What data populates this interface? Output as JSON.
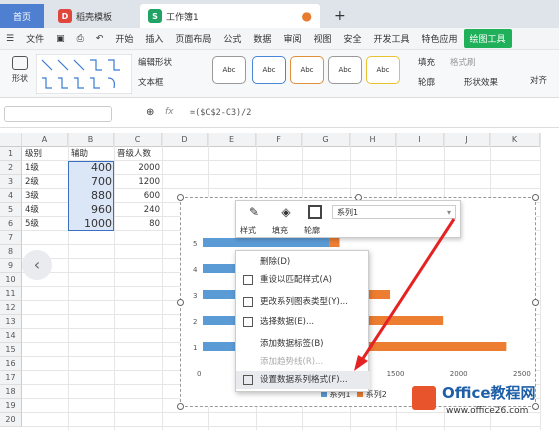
{
  "tabs": {
    "home": "首页",
    "template": "稻壳模板",
    "workbook": "工作簿1",
    "new_tab": "+"
  },
  "menu": {
    "file": "文件",
    "items": [
      "开始",
      "插入",
      "页面布局",
      "公式",
      "数据",
      "审阅",
      "视图",
      "安全",
      "开发工具",
      "特色应用"
    ],
    "active": "绘图工具"
  },
  "ribbon": {
    "shapes": "形状",
    "edit_shape": "编辑形状",
    "textbox": "文本框",
    "style_samples": [
      "Abc",
      "Abc",
      "Abc",
      "Abc",
      "Abc"
    ],
    "fill": "填充",
    "format_painter": "格式刷",
    "outline": "轮廓",
    "shape_effects": "形状效果",
    "align": "对齐"
  },
  "formula_bar": {
    "fx": "fx",
    "formula": "=($C$2-C3)/2"
  },
  "columns": [
    "A",
    "B",
    "C",
    "D",
    "E",
    "F",
    "G",
    "H",
    "I",
    "J",
    "K"
  ],
  "rows": [
    "1",
    "2",
    "3",
    "4",
    "5",
    "6",
    "7",
    "8",
    "9",
    "10",
    "11",
    "12",
    "13",
    "14",
    "15",
    "16",
    "17",
    "18",
    "19",
    "20"
  ],
  "table": {
    "headers": [
      "级别",
      "辅助",
      "晋级人数"
    ],
    "rows": [
      [
        "1级",
        "400",
        "2000"
      ],
      [
        "2级",
        "700",
        "1200"
      ],
      [
        "3级",
        "880",
        "600"
      ],
      [
        "4级",
        "960",
        "240"
      ],
      [
        "5级",
        "1000",
        "80"
      ]
    ]
  },
  "chart_data": {
    "type": "bar",
    "orientation": "horizontal",
    "stacked": true,
    "categories": [
      "1",
      "2",
      "3",
      "4",
      "5"
    ],
    "series": [
      {
        "name": "系列1",
        "values": [
          400,
          700,
          880,
          960,
          1000
        ],
        "color": "#5b9bd5"
      },
      {
        "name": "系列2",
        "values": [
          2000,
          1200,
          600,
          240,
          80
        ],
        "color": "#ed7d31"
      }
    ],
    "x_ticks": [
      "0",
      "1500",
      "2000",
      "2500"
    ],
    "xlim": [
      0,
      2500
    ],
    "legend": "bottom"
  },
  "mini_toolbar": {
    "style": "样式",
    "fill": "填充",
    "outline": "轮廓",
    "series_select": "系列1"
  },
  "context_menu": [
    "删除(D)",
    "重设以匹配样式(A)",
    "更改系列图表类型(Y)...",
    "选择数据(E)...",
    "添加数据标签(B)",
    "添加趋势线(R)...",
    "设置数据系列格式(F)..."
  ],
  "watermark": {
    "brand": "Office教程网",
    "url": "www.office26.com"
  }
}
